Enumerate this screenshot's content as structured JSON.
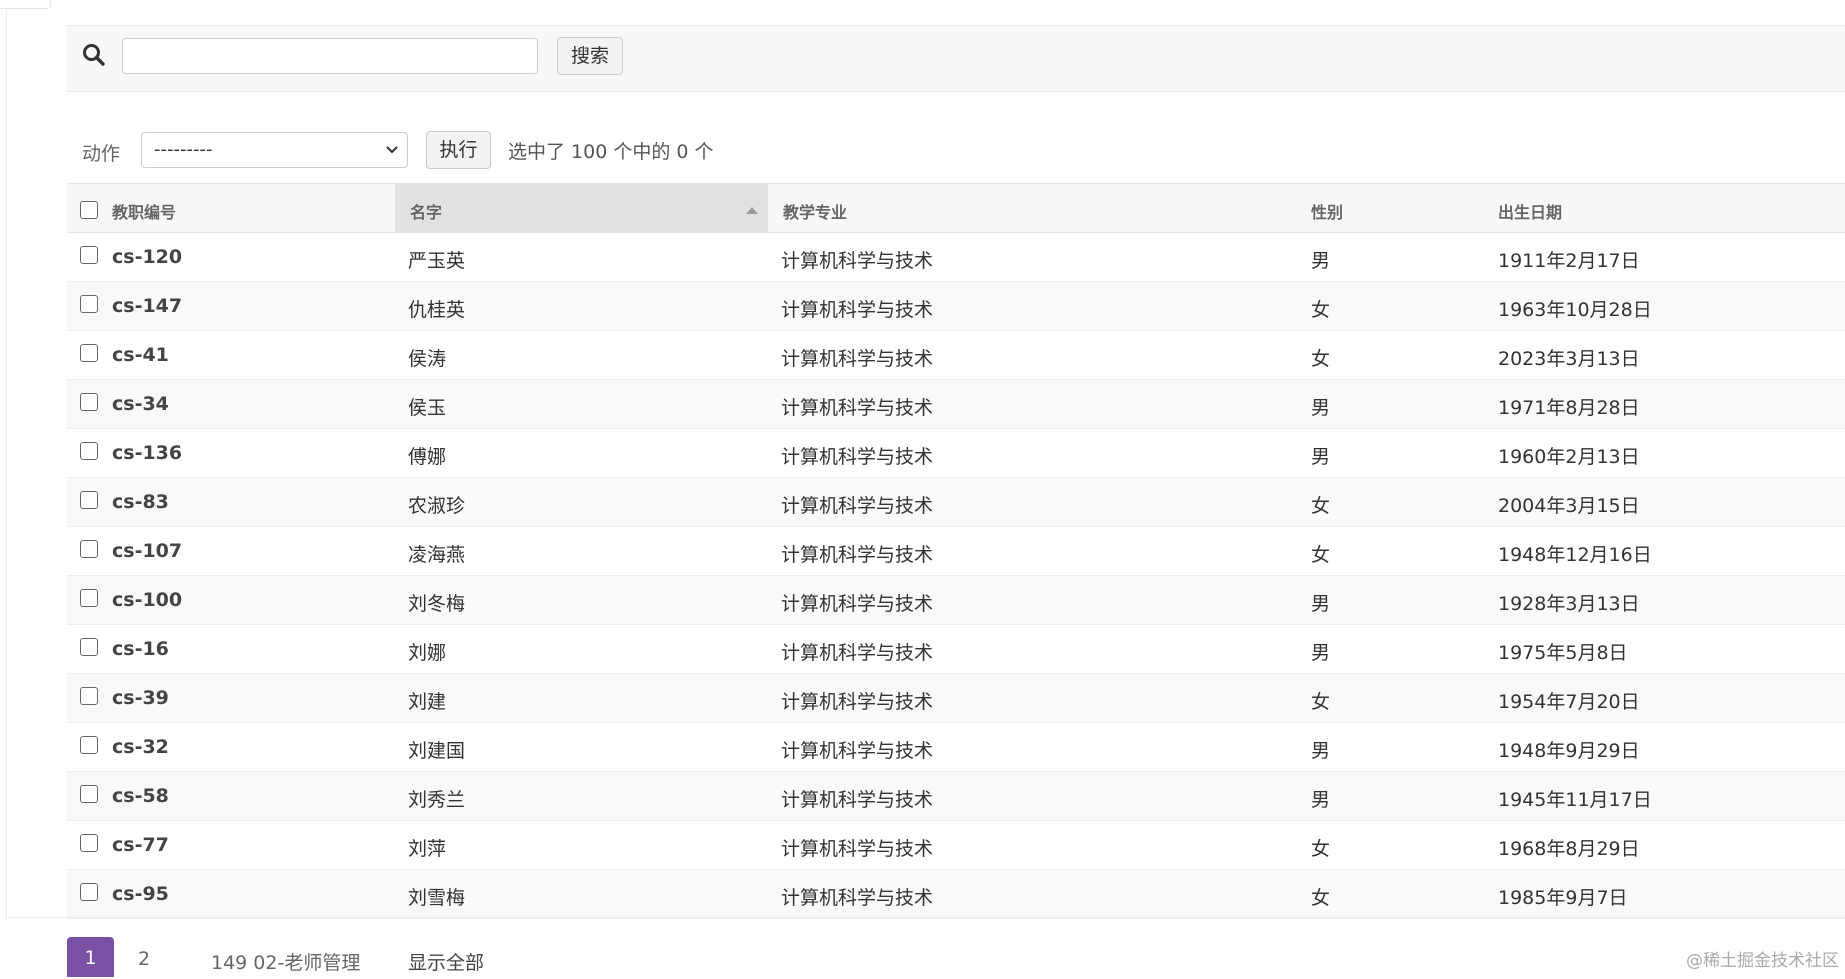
{
  "search": {
    "value": "",
    "placeholder": "",
    "button_label": "搜索"
  },
  "actions": {
    "label": "动作",
    "selected": "---------",
    "go_label": "执行",
    "counter": "选中了 100 个中的 0 个"
  },
  "table": {
    "columns": [
      "教职编号",
      "名字",
      "教学专业",
      "性别",
      "出生日期"
    ],
    "sorted_column": "名字",
    "rows": [
      {
        "id": "cs-120",
        "name": "严玉英",
        "major": "计算机科学与技术",
        "gender": "男",
        "birth": "1911年2月17日"
      },
      {
        "id": "cs-147",
        "name": "仇桂英",
        "major": "计算机科学与技术",
        "gender": "女",
        "birth": "1963年10月28日"
      },
      {
        "id": "cs-41",
        "name": "侯涛",
        "major": "计算机科学与技术",
        "gender": "女",
        "birth": "2023年3月13日"
      },
      {
        "id": "cs-34",
        "name": "侯玉",
        "major": "计算机科学与技术",
        "gender": "男",
        "birth": "1971年8月28日"
      },
      {
        "id": "cs-136",
        "name": "傅娜",
        "major": "计算机科学与技术",
        "gender": "男",
        "birth": "1960年2月13日"
      },
      {
        "id": "cs-83",
        "name": "农淑珍",
        "major": "计算机科学与技术",
        "gender": "女",
        "birth": "2004年3月15日"
      },
      {
        "id": "cs-107",
        "name": "凌海燕",
        "major": "计算机科学与技术",
        "gender": "女",
        "birth": "1948年12月16日"
      },
      {
        "id": "cs-100",
        "name": "刘冬梅",
        "major": "计算机科学与技术",
        "gender": "男",
        "birth": "1928年3月13日"
      },
      {
        "id": "cs-16",
        "name": "刘娜",
        "major": "计算机科学与技术",
        "gender": "男",
        "birth": "1975年5月8日"
      },
      {
        "id": "cs-39",
        "name": "刘建",
        "major": "计算机科学与技术",
        "gender": "女",
        "birth": "1954年7月20日"
      },
      {
        "id": "cs-32",
        "name": "刘建国",
        "major": "计算机科学与技术",
        "gender": "男",
        "birth": "1948年9月29日"
      },
      {
        "id": "cs-58",
        "name": "刘秀兰",
        "major": "计算机科学与技术",
        "gender": "男",
        "birth": "1945年11月17日"
      },
      {
        "id": "cs-77",
        "name": "刘萍",
        "major": "计算机科学与技术",
        "gender": "女",
        "birth": "1968年8月29日"
      },
      {
        "id": "cs-95",
        "name": "刘雪梅",
        "major": "计算机科学与技术",
        "gender": "女",
        "birth": "1985年9月7日"
      }
    ]
  },
  "paginator": {
    "current_page": "1",
    "other_page": "2",
    "result_count": "149 02-老师管理",
    "show_all": "显示全部"
  },
  "watermark": "@稀土掘金技术社区",
  "colors": {
    "accent": "#7a50a4",
    "header_bg": "#f8f8f8",
    "sorted_header_bg": "#e1e1e1"
  }
}
